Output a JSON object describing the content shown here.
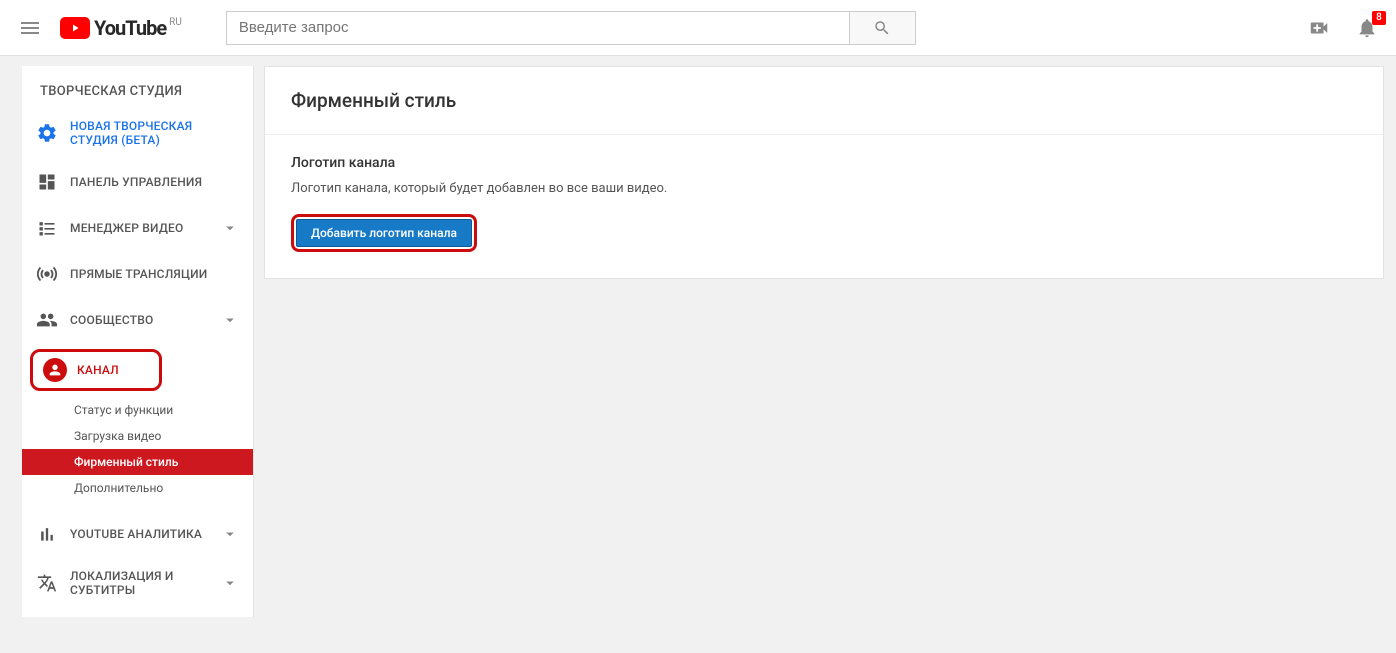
{
  "header": {
    "logo_text": "YouTube",
    "country_code": "RU",
    "search_placeholder": "Введите запрос",
    "notification_count": "8"
  },
  "sidebar": {
    "title": "ТВОРЧЕСКАЯ СТУДИЯ",
    "beta_label": "НОВАЯ ТВОРЧЕСКАЯ СТУДИЯ (БЕТА)",
    "dashboard_label": "ПАНЕЛЬ УПРАВЛЕНИЯ",
    "video_manager_label": "МЕНЕДЖЕР ВИДЕО",
    "live_label": "ПРЯМЫЕ ТРАНСЛЯЦИИ",
    "community_label": "СООБЩЕСТВО",
    "channel_label": "КАНАЛ",
    "channel_sub": {
      "status": "Статус и функции",
      "upload": "Загрузка видео",
      "branding": "Фирменный стиль",
      "advanced": "Дополнительно"
    },
    "analytics_label": "YOUTUBE АНАЛИТИКА",
    "translations_label": "ЛОКАЛИЗАЦИЯ И СУБТИТРЫ"
  },
  "main": {
    "page_title": "Фирменный стиль",
    "section_title": "Логотип канала",
    "section_desc": "Логотип канала, который будет добавлен во все ваши видео.",
    "add_logo_button": "Добавить логотип канала"
  }
}
